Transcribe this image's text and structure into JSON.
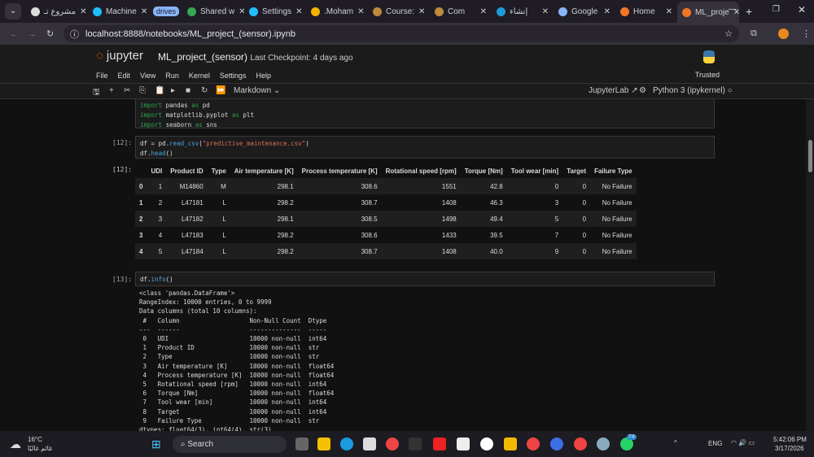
{
  "browser": {
    "tabs": [
      {
        "label": "مشروع تـ",
        "color": "#dddddd"
      },
      {
        "label": "Machine",
        "color": "#20beff"
      },
      {
        "label": "drives",
        "group": true
      },
      {
        "label": "Shared w",
        "color": "#34a853"
      },
      {
        "label": "Settings",
        "color": "#20beff"
      },
      {
        "label": ".Moham",
        "color": "#f4b400"
      },
      {
        "label": "Course:",
        "color": "#c08a3e"
      },
      {
        "label": "Com",
        "color": "#c08a3e"
      },
      {
        "label": "إنشاء",
        "color": "#1e9bd7"
      },
      {
        "label": "Google",
        "color": "#8ab4f8"
      },
      {
        "label": "Home",
        "color": "#f37626"
      },
      {
        "label": "ML_proje",
        "color": "#f37626",
        "active": true
      }
    ],
    "url": "localhost:8888/notebooks/ML_project_(sensor).ipynb"
  },
  "jupyter": {
    "logo": "jupyter",
    "notebook_name": "ML_project_(sensor)",
    "checkpoint": "Last Checkpoint: 4 days ago",
    "menu": [
      "File",
      "Edit",
      "View",
      "Run",
      "Kernel",
      "Settings",
      "Help"
    ],
    "trusted": "Trusted",
    "cell_type": "Markdown",
    "jupyterlab": "JupyterLab",
    "kernel": "Python 3 (ipykernel)"
  },
  "cells": {
    "imports": [
      {
        "kw": "import",
        "mod": " pandas ",
        "as": "as",
        "alias": " pd"
      },
      {
        "kw": "import",
        "mod": " matplotlib.pyplot ",
        "as": "as",
        "alias": " plt"
      },
      {
        "kw": "import",
        "mod": " seaborn ",
        "as": "as",
        "alias": " sns"
      }
    ],
    "c12": {
      "prompt": "[12]:",
      "line1_a": "df = pd.",
      "line1_fn": "read_csv",
      "line1_b": "(",
      "line1_str": "\"predictive_maintenance.csv\"",
      "line1_c": ")",
      "line2_a": "df.",
      "line2_fn": "head",
      "line2_b": "()",
      "out_prompt": "[12]:"
    },
    "c13": {
      "prompt": "[13]:",
      "a": "df.",
      "fn": "info",
      "b": "()"
    }
  },
  "table": {
    "columns": [
      "",
      "UDI",
      "Product ID",
      "Type",
      "Air temperature [K]",
      "Process temperature [K]",
      "Rotational speed [rpm]",
      "Torque [Nm]",
      "Tool wear [min]",
      "Target",
      "Failure Type"
    ],
    "rows": [
      [
        "0",
        "1",
        "M14860",
        "M",
        "298.1",
        "308.6",
        "1551",
        "42.8",
        "0",
        "0",
        "No Failure"
      ],
      [
        "1",
        "2",
        "L47181",
        "L",
        "298.2",
        "308.7",
        "1408",
        "46.3",
        "3",
        "0",
        "No Failure"
      ],
      [
        "2",
        "3",
        "L47182",
        "L",
        "298.1",
        "308.5",
        "1498",
        "49.4",
        "5",
        "0",
        "No Failure"
      ],
      [
        "3",
        "4",
        "L47183",
        "L",
        "298.2",
        "308.6",
        "1433",
        "39.5",
        "7",
        "0",
        "No Failure"
      ],
      [
        "4",
        "5",
        "L47184",
        "L",
        "298.2",
        "308.7",
        "1408",
        "40.0",
        "9",
        "0",
        "No Failure"
      ]
    ]
  },
  "info_output": "<class 'pandas.DataFrame'>\nRangeIndex: 10000 entries, 0 to 9999\nData columns (total 10 columns):\n #   Column                   Non-Null Count  Dtype  \n---  ------                   --------------  -----  \n 0   UDI                      10000 non-null  int64  \n 1   Product ID               10000 non-null  str    \n 2   Type                     10000 non-null  str    \n 3   Air temperature [K]      10000 non-null  float64\n 4   Process temperature [K]  10000 non-null  float64\n 5   Rotational speed [rpm]   10000 non-null  int64  \n 6   Torque [Nm]              10000 non-null  float64\n 7   Tool wear [min]          10000 non-null  int64  \n 8   Target                   10000 non-null  int64  \n 9   Failure Type             10000 non-null  str    \ndtypes: float64(3), int64(4), str(3)",
  "taskbar": {
    "temp": "16°C",
    "weather": "غائم غالبًا",
    "search": "Search",
    "lang": "ENG",
    "time": "5:42:06 PM",
    "date": "3/17/2026",
    "badge": "74"
  }
}
